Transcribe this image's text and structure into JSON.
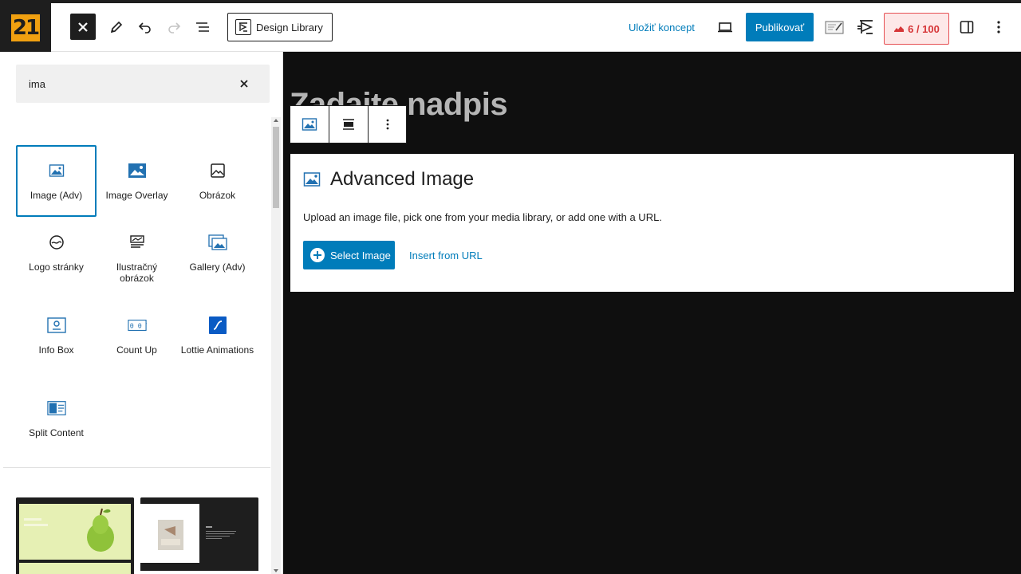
{
  "header": {
    "logo_text": "21",
    "design_library_label": "Design Library",
    "save_draft_label": "Uložiť koncept",
    "publish_label": "Publikovať",
    "score_label": "6 / 100"
  },
  "inserter": {
    "search": {
      "value": "ima",
      "placeholder": ""
    },
    "blocks": [
      {
        "label": "Image (Adv)",
        "icon": "image-icon",
        "selected": true
      },
      {
        "label": "Image Overlay",
        "icon": "image-overlay-icon"
      },
      {
        "label": "Obrázok",
        "icon": "image-outline-icon"
      },
      {
        "label": "Logo stránky",
        "icon": "site-logo-icon"
      },
      {
        "label": "Ilustračný obrázok",
        "icon": "featured-image-icon"
      },
      {
        "label": "Gallery (Adv)",
        "icon": "gallery-icon"
      },
      {
        "label": "Info Box",
        "icon": "info-box-icon"
      },
      {
        "label": "Count Up",
        "icon": "count-up-icon"
      },
      {
        "label": "Lottie Animations",
        "icon": "lottie-icon"
      },
      {
        "label": "Split Content",
        "icon": "split-content-icon"
      }
    ]
  },
  "canvas": {
    "post_title_placeholder": "Zadajte nadpis",
    "advanced_image": {
      "title": "Advanced Image",
      "description": "Upload an image file, pick one from your media library, or add one with a URL.",
      "select_image_label": "Select Image",
      "insert_url_label": "Insert from URL"
    }
  },
  "colors": {
    "accent": "#007cba",
    "canvas_bg": "#0f0f0f",
    "logo_bg": "#f0a010",
    "score_text": "#d63638"
  }
}
